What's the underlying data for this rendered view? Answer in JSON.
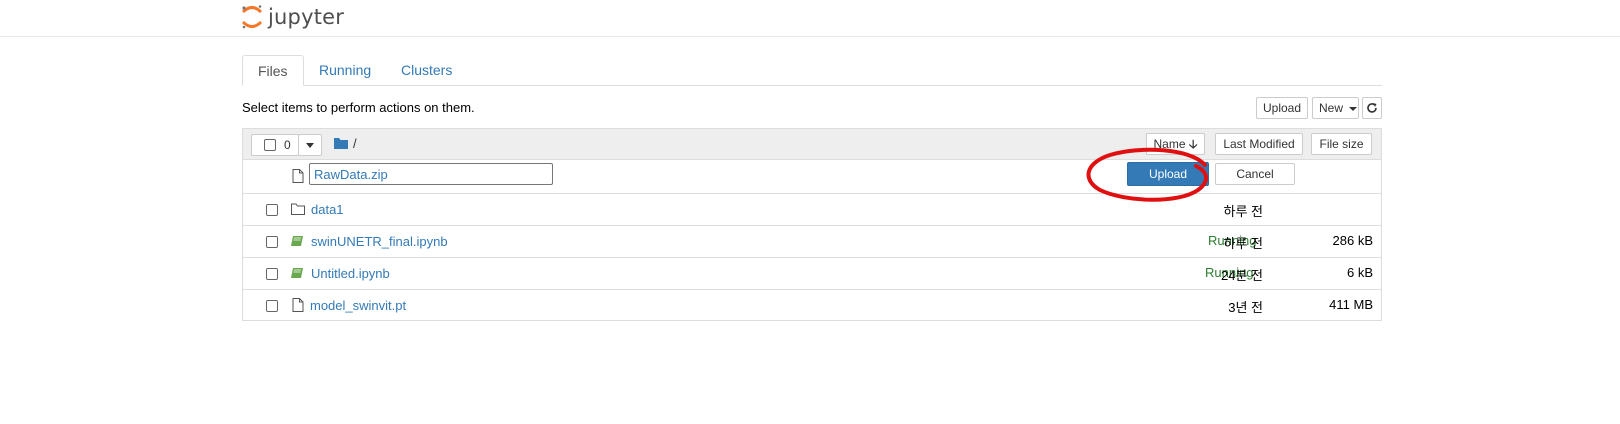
{
  "header": {
    "logo_text": "jupyter"
  },
  "tabs": [
    {
      "label": "Files",
      "active": true
    },
    {
      "label": "Running",
      "active": false
    },
    {
      "label": "Clusters",
      "active": false
    }
  ],
  "toolbar": {
    "info_text": "Select items to perform actions on them.",
    "upload_label": "Upload",
    "new_label": "New",
    "refresh_icon": "refresh-icon"
  },
  "list_header": {
    "selected_count": "0",
    "path": "/",
    "sort_name_label": "Name",
    "sort_modified_label": "Last Modified",
    "sort_size_label": "File size"
  },
  "upload_row": {
    "filename_value": "RawData.zip",
    "upload_label": "Upload",
    "cancel_label": "Cancel"
  },
  "items": [
    {
      "name": "data1",
      "type": "folder",
      "running": "",
      "modified": "하루 전",
      "size": ""
    },
    {
      "name": "swinUNETR_final.ipynb",
      "type": "notebook",
      "running": "Running",
      "modified": "하루 전",
      "size": "286 kB"
    },
    {
      "name": "Untitled.ipynb",
      "type": "notebook",
      "running": "Running",
      "modified": "24분 전",
      "size": "6 kB"
    },
    {
      "name": "model_swinvit.pt",
      "type": "file",
      "running": "",
      "modified": "3년 전",
      "size": "411 MB"
    }
  ],
  "colors": {
    "link": "#337ab7",
    "running": "#2e7d32",
    "primary_button": "#337ab7",
    "annotation": "#e01010"
  }
}
